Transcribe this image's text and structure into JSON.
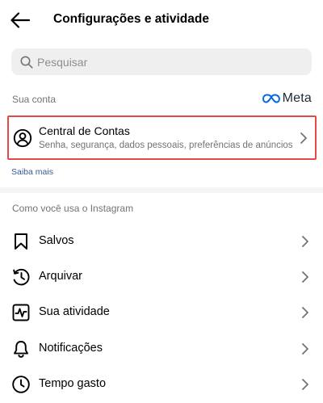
{
  "header": {
    "title": "Configurações e atividade"
  },
  "search": {
    "placeholder": "Pesquisar"
  },
  "account_section": {
    "label": "Sua conta",
    "brand": "Meta",
    "card": {
      "title": "Central de Contas",
      "subtitle": "Senha, segurança, dados pessoais, preferências de anúncios"
    },
    "learn_more": "Saiba mais"
  },
  "usage_section": {
    "label": "Como você usa o Instagram",
    "items": [
      {
        "label": "Salvos",
        "icon": "bookmark-icon"
      },
      {
        "label": "Arquivar",
        "icon": "archive-clock-icon"
      },
      {
        "label": "Sua atividade",
        "icon": "activity-icon"
      },
      {
        "label": "Notificações",
        "icon": "bell-icon"
      },
      {
        "label": "Tempo gasto",
        "icon": "clock-icon"
      }
    ]
  },
  "colors": {
    "highlight_border": "#e14a4a",
    "link": "#385898",
    "secondary_text": "#737373",
    "search_bg": "#efefef"
  }
}
